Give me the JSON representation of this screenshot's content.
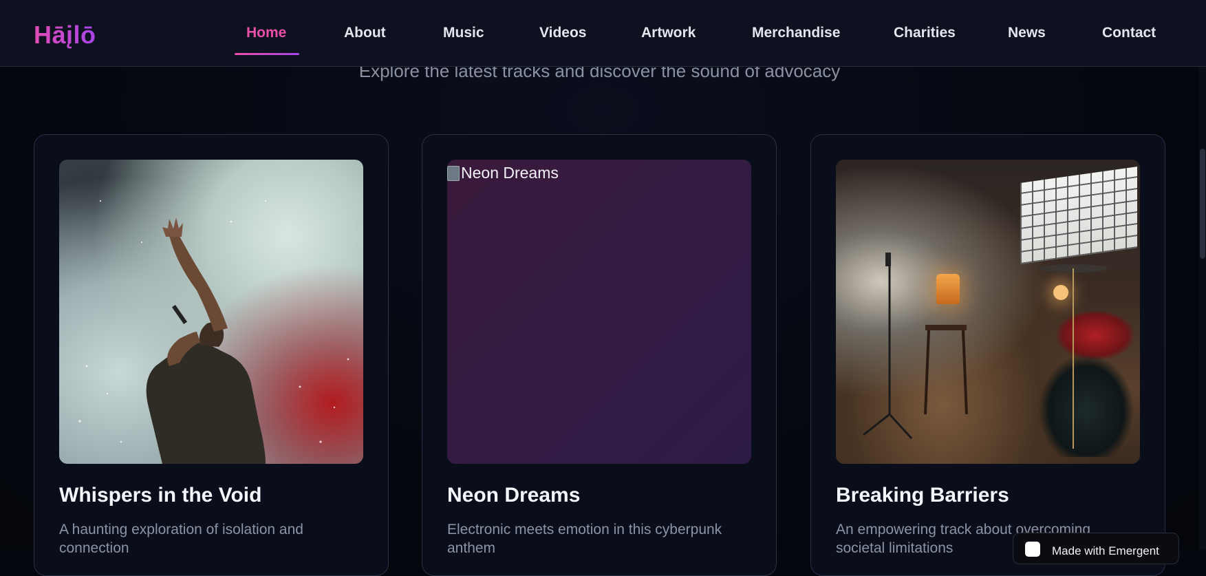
{
  "header": {
    "logo": "Hāįlō",
    "nav": [
      {
        "label": "Home",
        "active": true
      },
      {
        "label": "About"
      },
      {
        "label": "Music"
      },
      {
        "label": "Videos"
      },
      {
        "label": "Artwork"
      },
      {
        "label": "Merchandise"
      },
      {
        "label": "Charities"
      },
      {
        "label": "News"
      },
      {
        "label": "Contact"
      }
    ]
  },
  "section": {
    "subtitle": "Explore the latest tracks and discover the sound of advocacy"
  },
  "tracks": [
    {
      "title": "Whispers in the Void",
      "description": "A haunting exploration of isolation and connection",
      "image": "singer-photo"
    },
    {
      "title": "Neon Dreams",
      "description": "Electronic meets emotion in this cyberpunk anthem",
      "image_alt": "Neon Dreams"
    },
    {
      "title": "Breaking Barriers",
      "description": "An empowering track about overcoming societal limitations",
      "image": "studio-photo"
    }
  ],
  "badge": {
    "text": "Made with Emergent"
  },
  "colors": {
    "accent_pink": "#ec4fa9",
    "accent_purple": "#a644e8",
    "background": "#05070f"
  }
}
